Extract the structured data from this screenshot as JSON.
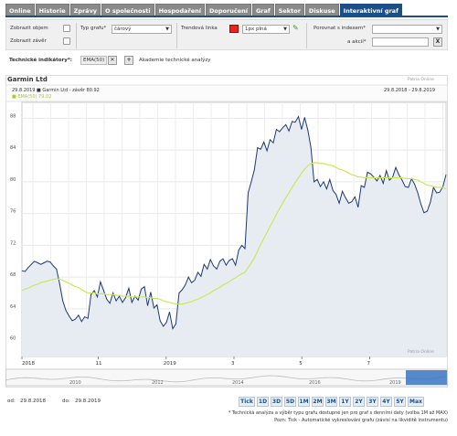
{
  "tabs": [
    {
      "label": "Online",
      "active": false
    },
    {
      "label": "Historie",
      "active": false
    },
    {
      "label": "Zprávy",
      "active": false
    },
    {
      "label": "O společnosti",
      "active": false
    },
    {
      "label": "Hospodaření",
      "active": false
    },
    {
      "label": "Doporučení",
      "active": false
    },
    {
      "label": "Graf",
      "active": false
    },
    {
      "label": "Sektor",
      "active": false
    },
    {
      "label": "Diskuse",
      "active": false
    },
    {
      "label": "Interaktivní graf",
      "active": true
    }
  ],
  "controls": {
    "show_volume_label": "Zobrazit objem",
    "show_close_label": "Zobrazit závěr",
    "chart_type_label": "Typ grafu*",
    "chart_type_value": "čárový",
    "trendline_label": "Trendová linka",
    "trendline_width": "1px plná",
    "compare_index_label": "Porovnat s indexem*",
    "compare_index_value": "",
    "and_stock_label": "a akcií*",
    "and_stock_value": "",
    "trendline_color": "#e8261f"
  },
  "indicators": {
    "label": "Technické indikátory*:",
    "chip": "EMA(50)",
    "academy_link": "Akademie technické analýzy"
  },
  "chart_header": {
    "company": "Garmin Ltd",
    "legend_line1": "29.8.2019 ■ Garmin Ltd - závěr 80.92",
    "legend_line2": "■ EMA(50) 79.02",
    "date_range": "29.8.2018 - 29.8.2019",
    "watermark_top": "Patria Online",
    "watermark_bottom": "Patria Online"
  },
  "navigator_labels": [
    "2010",
    "2012",
    "2014",
    "2016",
    "2019"
  ],
  "bottom": {
    "from_label": "od:",
    "from_value": "29.8.2018",
    "to_label": "do:",
    "to_value": "29.8.2019",
    "ranges": [
      "Tick",
      "1D",
      "3D",
      "5D",
      "1M",
      "2M",
      "3M",
      "1Y",
      "2Y",
      "3Y",
      "4Y",
      "5Y",
      "Max"
    ],
    "note1": "* Technická analýza a výběr typu grafu dostupné jen pro graf s denními daty (volba 1M až MAX)",
    "note2": "Pozn: Tick - Automatické vykreslování grafu (závisí na likviditě instrumentu)"
  },
  "colors": {
    "tab_active": "#1c4f8a",
    "price_line": "#1f3a6e",
    "ema_line": "#c9e85a",
    "area_fill": "#e7ecf3"
  },
  "chart_data": {
    "type": "area",
    "title": "Garmin Ltd",
    "x_tick_labels": [
      "2018",
      "11",
      "2019",
      "3",
      "5",
      "7"
    ],
    "y_ticks": [
      60,
      64,
      68,
      72,
      76,
      80,
      84,
      88
    ],
    "ylim": [
      58,
      90
    ],
    "grid": true,
    "series": [
      {
        "name": "Garmin Ltd - závěr",
        "values": [
          68.8,
          68.7,
          69.2,
          69.6,
          70.0,
          69.8,
          69.6,
          69.8,
          70.0,
          69.9,
          69.4,
          69.0,
          67.2,
          65.0,
          63.8,
          63.1,
          62.5,
          62.7,
          63.2,
          62.4,
          63.0,
          62.8,
          65.8,
          66.3,
          65.5,
          67.4,
          66.3,
          65.2,
          64.7,
          66.0,
          65.0,
          65.6,
          64.8,
          65.4,
          66.6,
          64.8,
          65.6,
          65.1,
          66.5,
          66.8,
          64.4,
          66.1,
          64.1,
          64.5,
          62.5,
          61.8,
          62.3,
          63.6,
          61.5,
          62.1,
          66.0,
          66.4,
          67.0,
          68.0,
          67.3,
          67.6,
          68.6,
          68.1,
          69.6,
          69.0,
          70.2,
          69.4,
          69.0,
          70.0,
          70.3,
          69.5,
          70.1,
          70.3,
          69.5,
          71.4,
          72.0,
          71.6,
          78.6,
          80.0,
          81.5,
          84.3,
          84.1,
          85.0,
          83.9,
          85.3,
          84.9,
          86.6,
          86.3,
          86.8,
          87.2,
          86.4,
          87.6,
          87.5,
          88.2,
          86.6,
          88.1,
          86.5,
          84.3,
          80.0,
          80.3,
          79.4,
          80.0,
          79.1,
          80.3,
          78.9,
          78.4,
          77.3,
          78.8,
          78.0,
          77.3,
          77.5,
          78.1,
          76.8,
          79.5,
          79.3,
          81.2,
          81.0,
          80.6,
          80.1,
          80.8,
          79.8,
          81.4,
          80.2,
          80.6,
          81.8,
          80.9,
          80.2,
          79.4,
          79.3,
          80.4,
          79.7,
          78.6,
          77.2,
          76.1,
          76.3,
          77.4,
          79.3,
          78.6,
          78.7,
          79.4,
          80.9
        ]
      },
      {
        "name": "EMA(50)",
        "values": [
          66.3,
          66.5,
          66.6,
          66.8,
          67.0,
          67.1,
          67.3,
          67.4,
          67.5,
          67.6,
          67.7,
          67.8,
          67.7,
          67.6,
          67.4,
          67.2,
          67.0,
          66.8,
          66.7,
          66.4,
          66.2,
          66.0,
          66.0,
          66.0,
          65.9,
          65.9,
          65.9,
          65.8,
          65.8,
          65.8,
          65.7,
          65.7,
          65.6,
          65.6,
          65.6,
          65.5,
          65.5,
          65.5,
          65.5,
          65.5,
          65.4,
          65.4,
          65.3,
          65.3,
          65.2,
          65.0,
          64.9,
          64.8,
          64.7,
          64.6,
          64.6,
          64.6,
          64.7,
          64.8,
          64.9,
          65.1,
          65.2,
          65.4,
          65.6,
          65.8,
          66.0,
          66.3,
          66.5,
          66.7,
          67.0,
          67.2,
          67.4,
          67.7,
          67.9,
          68.2,
          68.4,
          68.6,
          69.2,
          69.8,
          70.4,
          71.3,
          72.1,
          72.9,
          73.6,
          74.4,
          75.1,
          75.9,
          76.6,
          77.3,
          78.0,
          78.6,
          79.3,
          79.9,
          80.5,
          81.1,
          81.6,
          82.0,
          82.3,
          82.4,
          82.4,
          82.3,
          82.3,
          82.2,
          82.1,
          82.0,
          81.8,
          81.6,
          81.5,
          81.3,
          81.1,
          80.9,
          80.8,
          80.6,
          80.6,
          80.5,
          80.5,
          80.5,
          80.5,
          80.5,
          80.5,
          80.5,
          80.5,
          80.5,
          80.5,
          80.5,
          80.5,
          80.5,
          80.4,
          80.4,
          80.4,
          80.3,
          80.2,
          80.0,
          79.8,
          79.6,
          79.5,
          79.4,
          79.3,
          79.3,
          79.3,
          79.1
        ]
      }
    ]
  }
}
